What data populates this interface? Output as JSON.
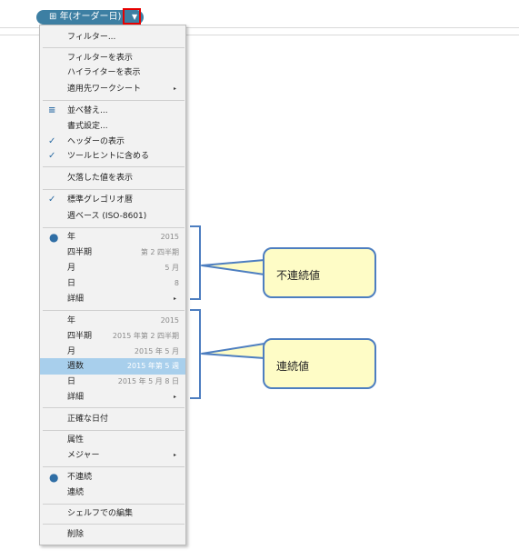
{
  "pill": {
    "icon": "calendar-icon",
    "icon_glyph": "⊞",
    "label": "年(オーダー日)",
    "caret": "▼"
  },
  "menu": {
    "items": [
      {
        "key": "filter",
        "label": "フィルター..."
      },
      {
        "key": "show_filter",
        "label": "フィルターを表示"
      },
      {
        "key": "show_highlighter",
        "label": "ハイライターを表示"
      },
      {
        "key": "apply_worksheet",
        "label": "適用先ワークシート",
        "submenu": "▸"
      },
      {
        "key": "sort",
        "label": "並べ替え...",
        "icon": "sort-icon"
      },
      {
        "key": "format",
        "label": "書式設定..."
      },
      {
        "key": "show_header",
        "label": "ヘッダーの表示",
        "check": "✓"
      },
      {
        "key": "include_tooltip",
        "label": "ツールヒントに含める",
        "check": "✓"
      },
      {
        "key": "show_missing",
        "label": "欠落した値を表示"
      },
      {
        "key": "gregorian",
        "label": "標準グレゴリオ暦",
        "check": "✓"
      },
      {
        "key": "iso_week",
        "label": "週ベース (ISO-8601)"
      },
      {
        "key": "d_year",
        "label": "年",
        "value": "2015",
        "bullet": "●"
      },
      {
        "key": "d_quarter",
        "label": "四半期",
        "value": "第 2 四半期"
      },
      {
        "key": "d_month",
        "label": "月",
        "value": "5 月"
      },
      {
        "key": "d_day",
        "label": "日",
        "value": "8"
      },
      {
        "key": "d_more",
        "label": "詳細",
        "submenu": "▸"
      },
      {
        "key": "c_year",
        "label": "年",
        "value": "2015"
      },
      {
        "key": "c_quarter",
        "label": "四半期",
        "value": "2015 年第 2 四半期"
      },
      {
        "key": "c_month",
        "label": "月",
        "value": "2015 年 5 月"
      },
      {
        "key": "c_week",
        "label": "週数",
        "value": "2015 年第 5 週"
      },
      {
        "key": "c_day",
        "label": "日",
        "value": "2015 年 5 月 8 日"
      },
      {
        "key": "c_more",
        "label": "詳細",
        "submenu": "▸"
      },
      {
        "key": "exact_date",
        "label": "正確な日付"
      },
      {
        "key": "attribute",
        "label": "属性"
      },
      {
        "key": "measure",
        "label": "メジャー",
        "submenu": "▸"
      },
      {
        "key": "discrete",
        "label": "不連続",
        "bullet": "●"
      },
      {
        "key": "continuous",
        "label": "連続"
      },
      {
        "key": "edit_shelf",
        "label": "シェルフでの編集"
      },
      {
        "key": "remove",
        "label": "削除"
      }
    ]
  },
  "callouts": {
    "discrete": "不連続値",
    "continuous": "連続値"
  },
  "colors": {
    "pill": "#3d7fa3",
    "highlight": "#a8cfec",
    "callout_fill": "#fefcc6",
    "callout_border": "#4d7ec0",
    "red_box": "#e60000"
  }
}
